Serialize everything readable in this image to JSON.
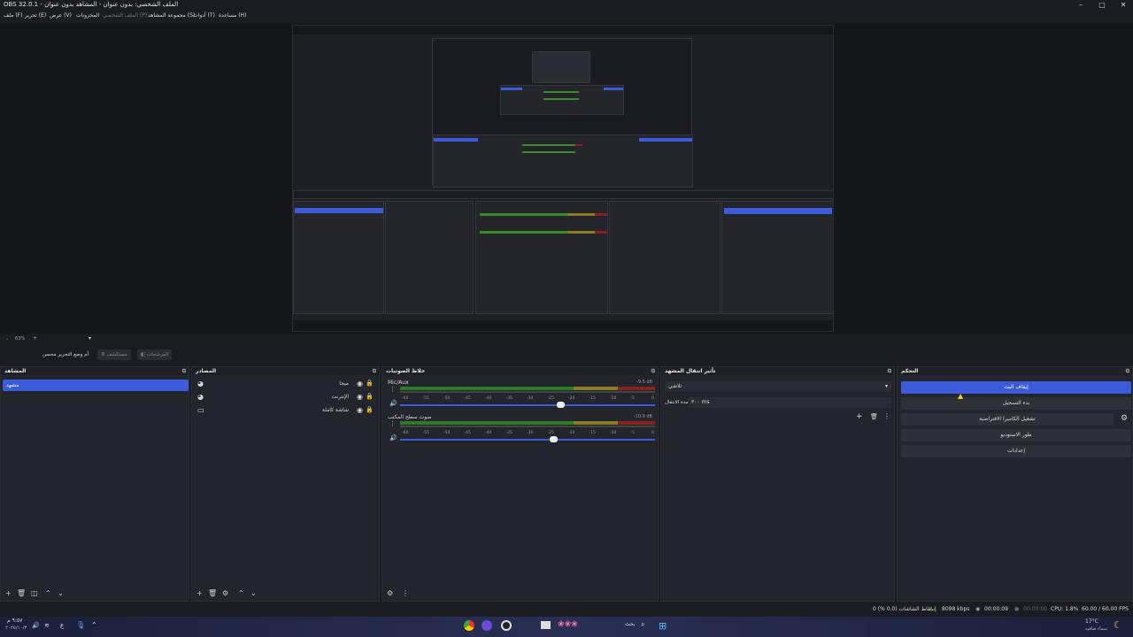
{
  "window": {
    "title": "OBS 32.0.1 - الملف الشخصي: بدون عنوان - المشاهد بدون عنوان",
    "minimize": "–",
    "maximize": "▢",
    "close": "✕"
  },
  "menu": {
    "items": [
      "ملف (F)",
      "تحرير (E)",
      "عرض (V)",
      "الملف الشخصي (P)",
      "مجموعة المشاهد (S)",
      "أدوات (T)",
      "مساعدة (H)",
      "المخزونات"
    ]
  },
  "toolbar": {
    "zoom": "63%",
    "studio_mode": "أم وضع التحرير محسن",
    "settings_btn": "مستكشف",
    "filters_btn": "المرشحات"
  },
  "docks": {
    "scenes": {
      "title": "المشاهد",
      "items": [
        "مشهد"
      ]
    },
    "sources": {
      "title": "المصادر",
      "items": [
        "ميجا",
        "الإنترنت",
        "شاشة كاملة"
      ]
    },
    "mixer": {
      "title": "خلاط الصوتيات",
      "tracks": [
        {
          "name": "Mic/Aux",
          "level": "-9.5 dB",
          "fader": 0.63
        },
        {
          "name": "صوت سطح المكتب",
          "level": "-10.9 dB",
          "fader": 0.6
        }
      ],
      "scale": [
        "-60",
        "-55",
        "-50",
        "-45",
        "-40",
        "-35",
        "-30",
        "-25",
        "-20",
        "-15",
        "-10",
        "-5",
        "0"
      ]
    },
    "transitions": {
      "title": "تأثير انتقال المشهد",
      "type": "تلاشي",
      "duration_label": "مدة الانتقال",
      "duration_value": "٣٠٠ ms"
    },
    "controls": {
      "title": "التحكم",
      "buttons": [
        "إيقاف البث",
        "بدء التسجيل",
        "تشغيل الكاميرا الافتراضية",
        "طور الاستوديو",
        "إعدادات"
      ]
    }
  },
  "statusbar": {
    "dropped": "إسقاط الشاشات (0.0 %) 0",
    "bitrate": "8098 kbps",
    "stream_time": "00:00:09",
    "rec_time": "00:00:00",
    "cpu": "CPU: 1.8%",
    "fps": "60.00 / 60.00 FPS"
  },
  "taskbar": {
    "search": "بحث",
    "weather_temp": "17°C",
    "weather_desc": "سماء صافية",
    "time": "٩:٥٧ م",
    "date": "٢٠٢٥/١٠/٣",
    "lang": "ع"
  },
  "colors": {
    "accent": "#3b5bdb",
    "green": "#3a8a2a",
    "yellow": "#8a7a20",
    "red": "#8a2020"
  }
}
